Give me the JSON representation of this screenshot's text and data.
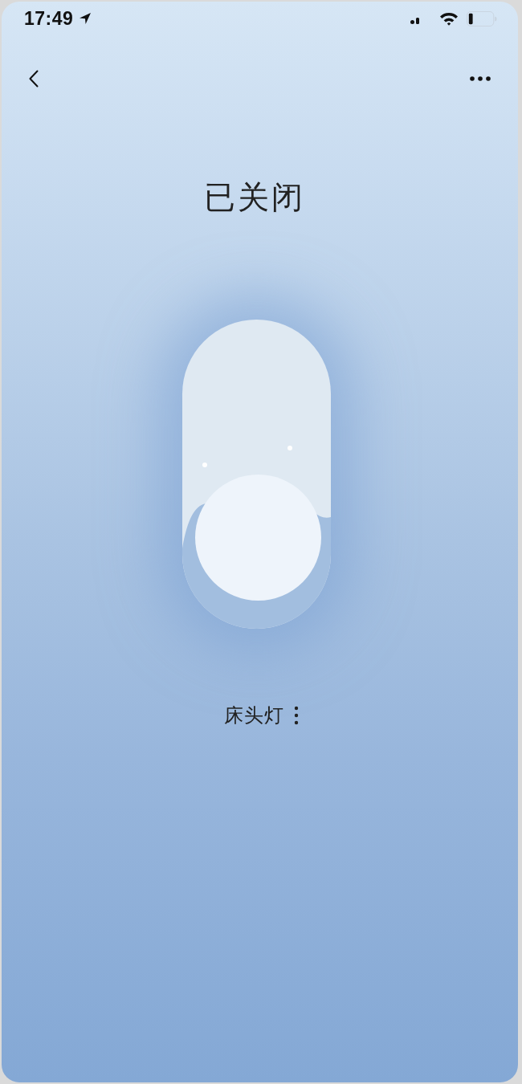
{
  "status_bar": {
    "time": "17:49"
  },
  "title": "已关闭",
  "switch": {
    "on": false
  },
  "device": {
    "name": "床头灯"
  }
}
